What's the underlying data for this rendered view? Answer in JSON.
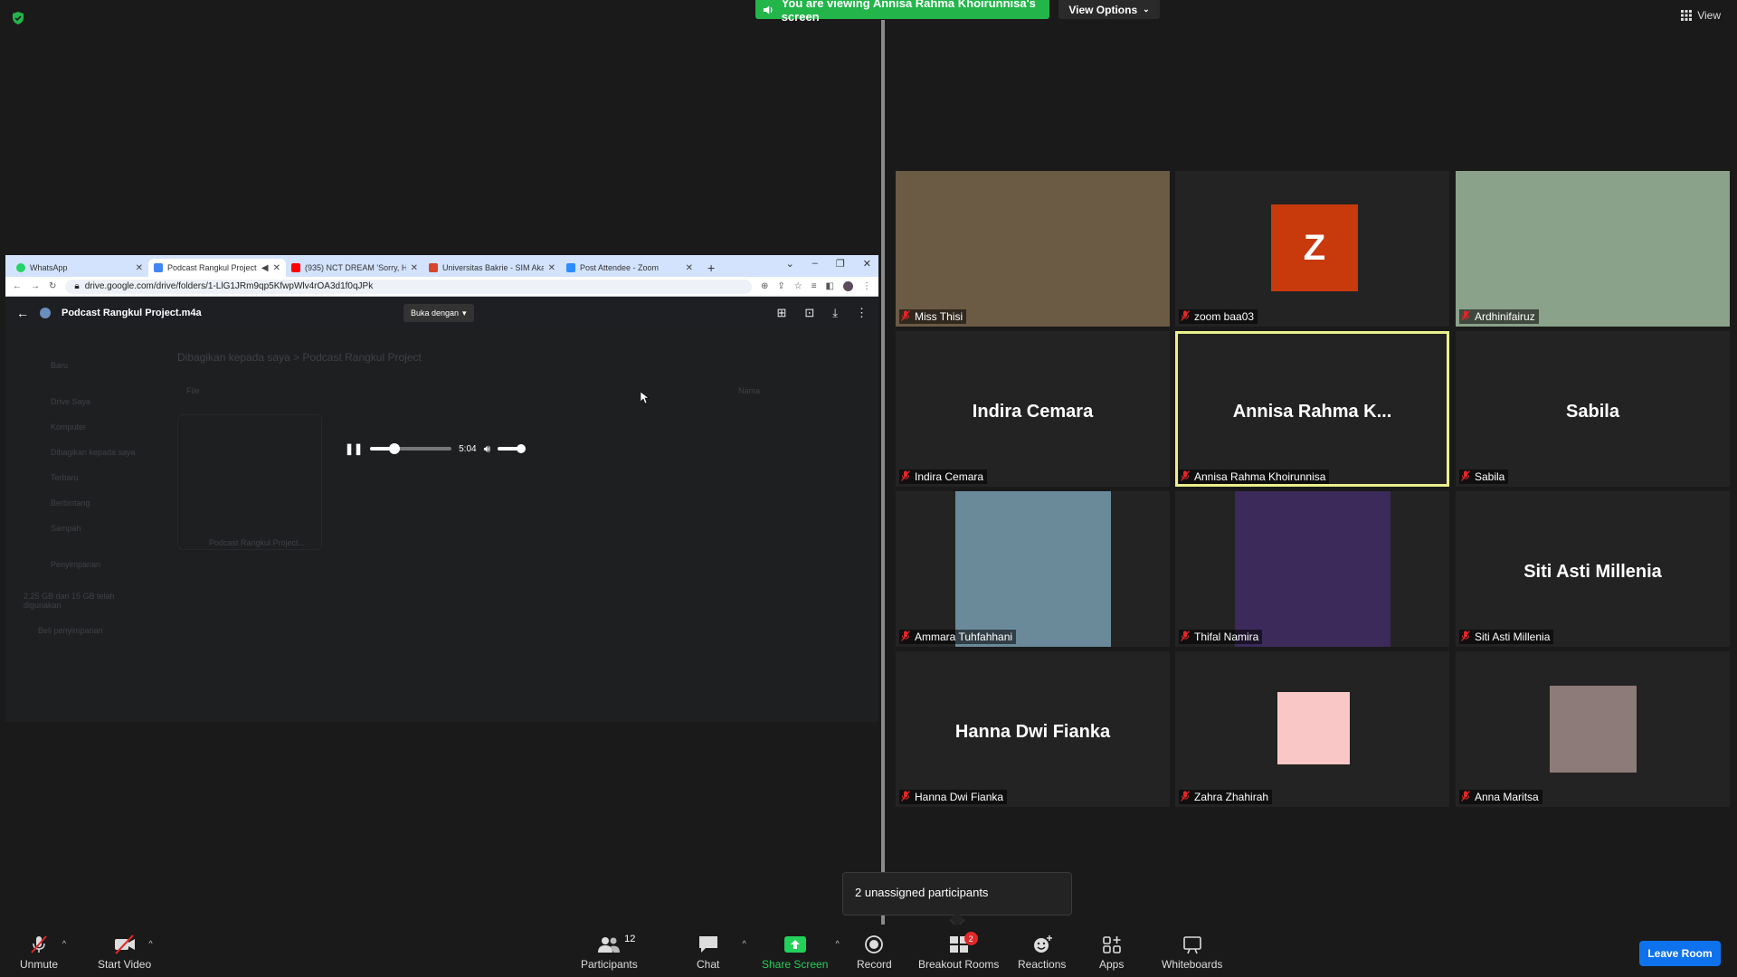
{
  "banner": {
    "viewing_text": "You are viewing Annisa Rahma Khoirunnisa's screen",
    "view_options_label": "View Options",
    "view_label": "View"
  },
  "shared_screen": {
    "tabs": [
      {
        "label": "WhatsApp",
        "color": "#25d366"
      },
      {
        "label": "Podcast Rangkul Project",
        "color": "#4285f4"
      },
      {
        "label": "(935) NCT DREAM 'Sorry, He",
        "color": "#ff0000"
      },
      {
        "label": "Universitas Bakrie - SIM Aka",
        "color": "#d9442c"
      },
      {
        "label": "Post Attendee - Zoom",
        "color": "#2d8cff"
      }
    ],
    "url": "drive.google.com/drive/folders/1-LlG1JRm9qp5KfwpWlv4rOA3d1f0qJPk",
    "file_name": "Podcast Rangkul Project.m4a",
    "open_with_label": "Buka dengan",
    "player_time": "5:04",
    "player_progress": 0.3,
    "sidebar": [
      "Baru",
      "Drive Saya",
      "Komputer",
      "Dibagikan kepada saya",
      "Terbaru",
      "Berbintang",
      "Sampah",
      "Penyimpanan",
      "2,25 GB dari 15 GB telah digunakan",
      "Beli penyimpanan"
    ],
    "breadcrumb": "Dibagikan kepada saya  >  Podcast Rangkul Project",
    "file_column": "File",
    "name_column": "Nama",
    "card_name": "Podcast Rangkul Project..."
  },
  "participants": [
    {
      "name": "Miss Thisi",
      "type": "video",
      "bg": "#6b5a44"
    },
    {
      "name": "zoom baa03",
      "type": "avatar",
      "avatar_letter": "Z"
    },
    {
      "name": "Ardhinifairuz",
      "type": "video",
      "bg": "#8aa18a"
    },
    {
      "name": "Indira Cemara",
      "type": "name"
    },
    {
      "name": "Annisa Rahma Khoirunnisa",
      "display": "Annisa  Rahma  K...",
      "type": "name",
      "speaking": true
    },
    {
      "name": "Sabila",
      "type": "name"
    },
    {
      "name": "Ammara Tuhfahhani",
      "type": "photo",
      "bg": "#6a8a9a"
    },
    {
      "name": "Thifal Namira",
      "type": "photo",
      "bg": "#3b2a5a"
    },
    {
      "name": "Siti Asti Millenia",
      "type": "name"
    },
    {
      "name": "Hanna Dwi Fianka",
      "type": "name"
    },
    {
      "name": "Zahra Zhahirah",
      "type": "pink"
    },
    {
      "name": "Anna Maritsa",
      "type": "photo",
      "bg": "#8c7b78"
    }
  ],
  "popup": {
    "text": "2 unassigned participants"
  },
  "toolbar": {
    "unmute": "Unmute",
    "start_video": "Start Video",
    "participants": "Participants",
    "participants_count": "12",
    "chat": "Chat",
    "share_screen": "Share Screen",
    "record": "Record",
    "breakout_rooms": "Breakout Rooms",
    "breakout_badge": "2",
    "reactions": "Reactions",
    "apps": "Apps",
    "whiteboards": "Whiteboards",
    "leave_room": "Leave Room"
  },
  "colors": {
    "accent_green": "#23b54a",
    "leave_blue": "#0e72ed",
    "speaker_outline": "#e9f08c",
    "mic_off_red": "#e02828"
  }
}
